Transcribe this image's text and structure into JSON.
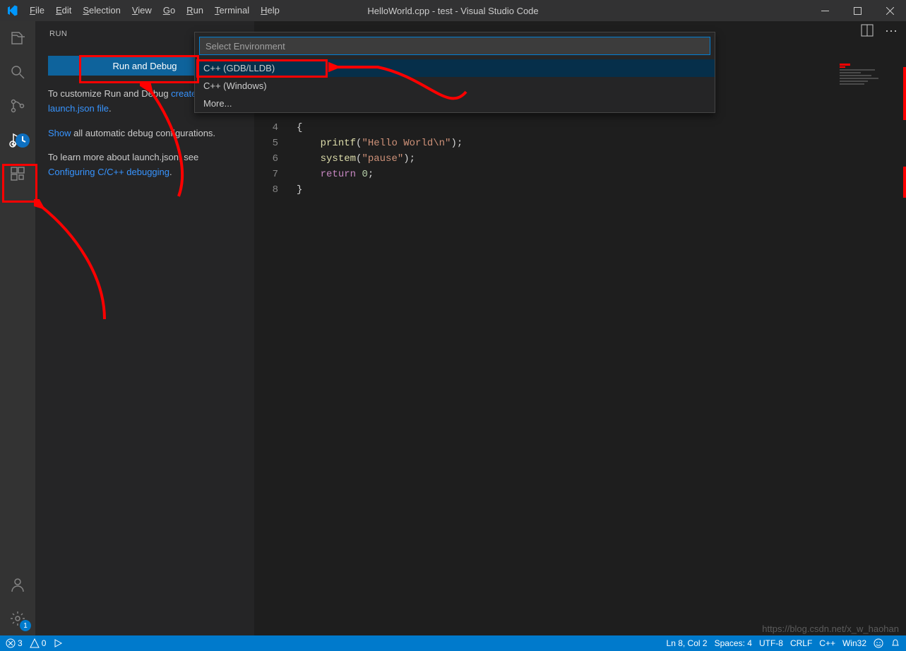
{
  "title": "HelloWorld.cpp - test - Visual Studio Code",
  "menu": {
    "file": "File",
    "edit": "Edit",
    "selection": "Selection",
    "view": "View",
    "go": "Go",
    "run": "Run",
    "terminal": "Terminal",
    "help": "Help"
  },
  "sidebar": {
    "header": "RUN",
    "run_button": "Run and Debug",
    "para1_a": "To customize Run and Debug ",
    "para1_link": "create a launch.json file",
    "para1_b": ".",
    "para2_link": "Show",
    "para2_a": " all automatic debug configurations.",
    "para3_a": "To learn more about launch.json, see ",
    "para3_link": "Configuring C/C++ debugging",
    "para3_b": "."
  },
  "quickpick": {
    "placeholder": "Select Environment",
    "opt1": "C++ (GDB/LLDB)",
    "opt2": "C++ (Windows)",
    "opt3": "More..."
  },
  "editor": {
    "lines": {
      "l4": "4",
      "l5": "5",
      "l6": "6",
      "l7": "7",
      "l8": "8"
    },
    "code4": "{",
    "code5_a": "    ",
    "code5_fn": "printf",
    "code5_b": "(",
    "code5_str": "\"Hello World\\n\"",
    "code5_c": ");",
    "code6_a": "    ",
    "code6_fn": "system",
    "code6_b": "(",
    "code6_str": "\"pause\"",
    "code6_c": ");",
    "code7_a": "    ",
    "code7_kw": "return",
    "code7_b": " ",
    "code7_num": "0",
    "code7_c": ";",
    "code8": "}"
  },
  "status": {
    "errors": "3",
    "warnings": "0",
    "ln_col": "Ln 8, Col 2",
    "spaces": "Spaces: 4",
    "encoding": "UTF-8",
    "eol": "CRLF",
    "lang": "C++",
    "win32": "Win32",
    "settings_badge": "1"
  },
  "watermark": "https://blog.csdn.net/x_w_haohan"
}
